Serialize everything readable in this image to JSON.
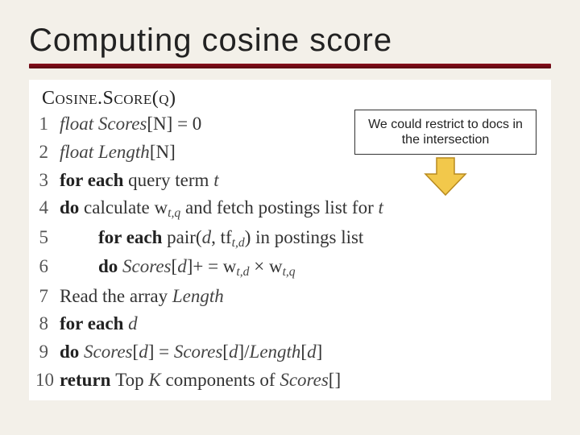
{
  "title": "Computing cosine score",
  "callout": "We could restrict to docs in the intersection",
  "fn_header": "Cosine.Score(q)",
  "lines": {
    "n1": "1",
    "l1a": "float Scores",
    "l1b": "[N] = 0",
    "n2": "2",
    "l2a": "float Length",
    "l2b": "[N]",
    "n3": "3",
    "l3a": "for   each",
    "l3b": "  query term ",
    "l3c": "t",
    "n4": "4",
    "l4a": "do ",
    "l4b": "calculate w",
    "l4sub": "t,q",
    "l4c": " and fetch postings list for ",
    "l4d": "t",
    "n5": "5",
    "l5a": "for   each",
    "l5b": "  pair(",
    "l5c": "d",
    "l5d": ", tf",
    "l5sub": "t,d",
    "l5e": ") in postings list",
    "n6": "6",
    "l6a": "do ",
    "l6b": "Scores",
    "l6c": "[",
    "l6d": "d",
    "l6e": "]+ = w",
    "l6sub1": "t,d",
    "l6f": " × w",
    "l6sub2": "t,q",
    "n7": "7",
    "l7a": "Read the array  ",
    "l7b": "Length",
    "n8": "8",
    "l8a": "for   each",
    "l8b": "  d",
    "n9": "9",
    "l9a": "do ",
    "l9b": "Scores",
    "l9c": "[",
    "l9d": "d",
    "l9e": "] = ",
    "l9f": "Scores",
    "l9g": "[",
    "l9h": "d",
    "l9i": "]/",
    "l9j": "Length",
    "l9k": "[",
    "l9l": "d",
    "l9m": "]",
    "n10": "10",
    "l10a": "return ",
    "l10b": "Top ",
    "l10c": "K",
    "l10d": " components of ",
    "l10e": "Scores",
    "l10f": "[]"
  }
}
